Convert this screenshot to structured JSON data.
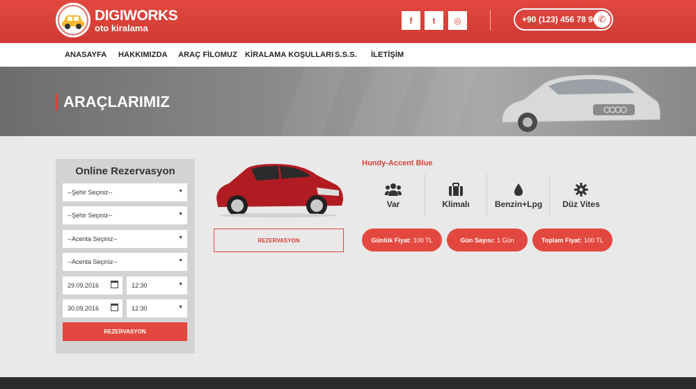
{
  "header": {
    "brand": "DIGIWORKS",
    "subtitle": "oto kiralama",
    "social": [
      {
        "icon": "facebook-icon",
        "glyph": "f"
      },
      {
        "icon": "twitter-icon",
        "glyph": "t"
      },
      {
        "icon": "instagram-icon",
        "glyph": "◎"
      }
    ],
    "phone": "+90 (123) 456 78 90"
  },
  "nav": {
    "items": [
      "ANASAYFA",
      "HAKKIMIZDA",
      "ARAÇ FİLOMUZ",
      "KİRALAMA KOŞULLARI",
      "S.S.S.",
      "İLETİŞİM"
    ]
  },
  "banner": {
    "title": "ARAÇLARIMIZ"
  },
  "reservation": {
    "title": "Online Rezervasyon",
    "city1": "--Şehir Seçiniz--",
    "city2": "--Şehir Seçiniz--",
    "agency1": "--Acenta Seçiniz--",
    "agency2": "--Acenta Seçiniz--",
    "pickup_date": "29.09.2016",
    "pickup_time": "12:30",
    "return_date": "30.09.2016",
    "return_time": "12:30",
    "button": "REZERVASYON"
  },
  "car": {
    "name": "Hundy-Accent Blue",
    "button": "REZERVASYON",
    "features": [
      {
        "icon": "users-icon",
        "label": "Var"
      },
      {
        "icon": "briefcase-icon",
        "label": "Klimalı"
      },
      {
        "icon": "fuel-drop-icon",
        "label": "Benzin+Lpg"
      },
      {
        "icon": "gear-icon",
        "label": "Düz Vites"
      }
    ],
    "pills": [
      {
        "label": "Günlük Fiyat:",
        "value": "100 TL"
      },
      {
        "label": "Gün Sayısı:",
        "value": "1 Gün"
      },
      {
        "label": "Toplam Fiyat:",
        "value": "100 TL"
      }
    ]
  },
  "colors": {
    "accent": "#e2483f",
    "panel": "#d3d3d3",
    "footer": "#2b2b2b"
  }
}
